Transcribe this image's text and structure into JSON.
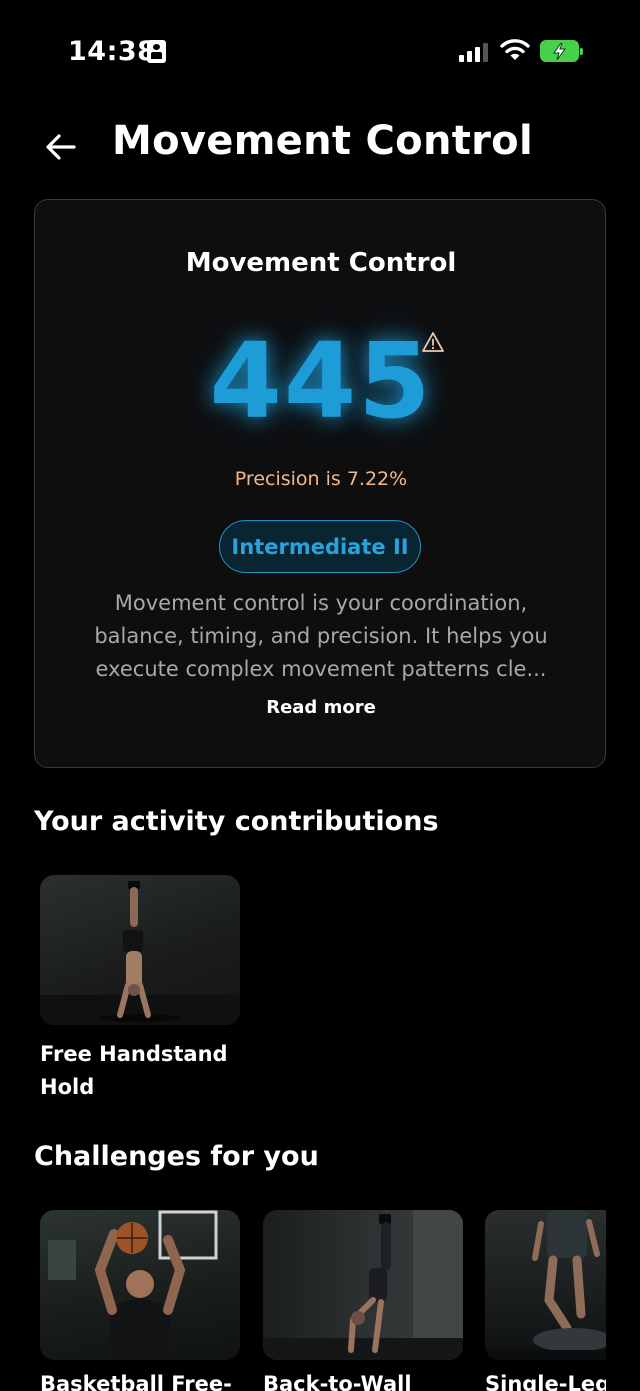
{
  "status_bar": {
    "time": "14:38",
    "icons": [
      "id-card-icon",
      "cellular-signal-icon",
      "wifi-icon",
      "battery-charging-icon"
    ],
    "battery_color": "#47d14a"
  },
  "header": {
    "back_icon": "arrow-left-icon",
    "title": "Movement Control"
  },
  "score_card": {
    "title": "Movement Control",
    "score": "445",
    "score_color": "#1e9cd8",
    "warning_icon": "warning-triangle-icon",
    "precision": "Precision is 7.22%",
    "level": "Intermediate II",
    "description": "Movement control is your coordination, balance, timing, and precision. It helps you execute complex movement patterns cle...",
    "read_more": "Read more"
  },
  "activity_section": {
    "title": "Your activity contributions",
    "items": [
      {
        "label": "Free Handstand Hold",
        "image": "handstand-photo"
      }
    ]
  },
  "challenges_section": {
    "title": "Challenges for you",
    "items": [
      {
        "label": "Basketball Free-",
        "image": "basketball-photo"
      },
      {
        "label": "Back-to-Wall",
        "image": "wall-handstand-photo"
      },
      {
        "label": "Single-Leg",
        "image": "balance-photo"
      }
    ]
  }
}
